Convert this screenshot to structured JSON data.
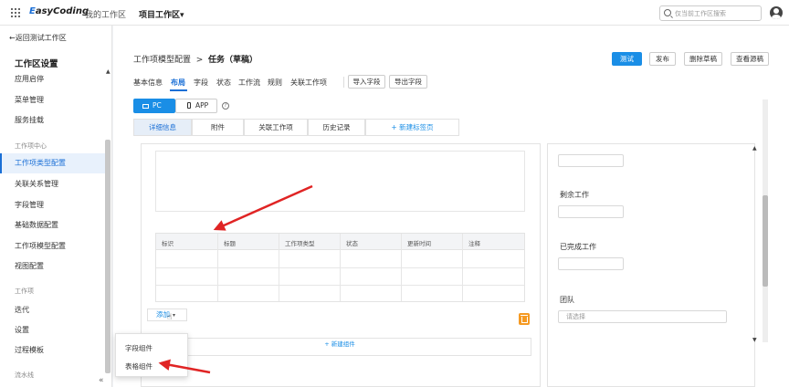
{
  "topbar": {
    "logo_e": "E",
    "logo_rest": "asyCoding",
    "nav_my": "我的工作区",
    "nav_project": "项目工作区",
    "nav_project_caret": "▾",
    "search_placeholder": "仅当前工作区搜索"
  },
  "sidebar": {
    "back": "←返回测试工作区",
    "title": "工作区设置",
    "group1": [
      "应用启停",
      "菜单管理",
      "服务挂载"
    ],
    "group_workitem": "工作项中心",
    "group2": [
      "工作项类型配置",
      "关联关系管理",
      "字段管理",
      "基础数据配置",
      "工作项模型配置",
      "视图配置"
    ],
    "group_work": "工作项",
    "group3": [
      "迭代",
      "设置",
      "过程模板"
    ],
    "group_pipeline": "流水线",
    "collapse": "«"
  },
  "header": {
    "crumb_prefix": "工作项模型配置",
    "crumb_sep": ">",
    "crumb_current": "任务（草稿）",
    "btn_test": "测试",
    "btn_publish": "发布",
    "btn_delete_draft": "删除草稿",
    "btn_view_draft": "查看源稿",
    "tabs": [
      "基本信息",
      "布局",
      "字段",
      "状态",
      "工作流",
      "规则",
      "关联工作项"
    ],
    "import_fields": "导入字段",
    "export_fields": "导出字段"
  },
  "content": {
    "pc_label": "PC",
    "app_label": "APP",
    "help": "?",
    "subtabs": [
      "详细信息",
      "附件",
      "关联工作项",
      "历史记录"
    ],
    "add_tab": "+ 新建标签页",
    "table_headers": [
      "标识",
      "标题",
      "工作项类型",
      "状态",
      "更新时间",
      "注释"
    ],
    "add_btn": "添加",
    "add_caret": "▾",
    "new_component": "+ 新建组件",
    "right_fields": [
      "剩余工作",
      "已完成工作",
      "团队"
    ],
    "team_placeholder": "请选择"
  },
  "dropdown": {
    "items": [
      "字段组件",
      "表格组件"
    ]
  },
  "colors": {
    "primary": "#1a8ee6",
    "accent_text": "#1a6fd6",
    "arrow": "#e02424",
    "trash": "#f59a23"
  }
}
